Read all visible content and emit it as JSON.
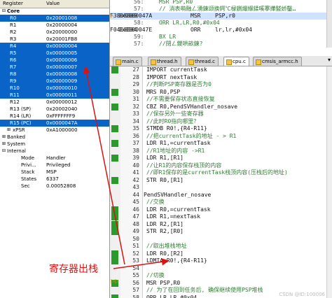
{
  "registers": {
    "header_name": "Register",
    "header_value": "Value",
    "rows": [
      {
        "tag": "⊟",
        "name": "Core",
        "value": "",
        "kind": "grp",
        "sel": false
      },
      {
        "tag": "",
        "name": "R0",
        "value": "0x20001008",
        "kind": "reg",
        "sel": true
      },
      {
        "tag": "",
        "name": "R1",
        "value": "0x20000004",
        "kind": "reg",
        "sel": false
      },
      {
        "tag": "",
        "name": "R2",
        "value": "0x20000000",
        "kind": "reg",
        "sel": false
      },
      {
        "tag": "",
        "name": "R3",
        "value": "0x20001FB8",
        "kind": "reg",
        "sel": false
      },
      {
        "tag": "",
        "name": "R4",
        "value": "0x00000004",
        "kind": "reg",
        "sel": true
      },
      {
        "tag": "",
        "name": "R5",
        "value": "0x00000005",
        "kind": "reg",
        "sel": true
      },
      {
        "tag": "",
        "name": "R6",
        "value": "0x00000006",
        "kind": "reg",
        "sel": true
      },
      {
        "tag": "",
        "name": "R7",
        "value": "0x00000007",
        "kind": "reg",
        "sel": true
      },
      {
        "tag": "",
        "name": "R8",
        "value": "0x00000008",
        "kind": "reg",
        "sel": true
      },
      {
        "tag": "",
        "name": "R9",
        "value": "0x00000009",
        "kind": "reg",
        "sel": true
      },
      {
        "tag": "",
        "name": "R10",
        "value": "0x00000010",
        "kind": "reg",
        "sel": true
      },
      {
        "tag": "",
        "name": "R11",
        "value": "0x00000011",
        "kind": "reg",
        "sel": true
      },
      {
        "tag": "",
        "name": "R12",
        "value": "0x00000012",
        "kind": "reg",
        "sel": false
      },
      {
        "tag": "",
        "name": "R13 (SP)",
        "value": "0x20002040",
        "kind": "reg",
        "sel": false
      },
      {
        "tag": "",
        "name": "R14 (LR)",
        "value": "0xFFFFFFF9",
        "kind": "reg",
        "sel": false
      },
      {
        "tag": "",
        "name": "R15 (PC)",
        "value": "0x0000047A",
        "kind": "reg",
        "sel": true
      },
      {
        "tag": "⊞",
        "name": "xPSR",
        "value": "0xA1000000",
        "kind": "grp2",
        "sel": false
      },
      {
        "tag": "⊞",
        "name": "Banked",
        "value": "",
        "kind": "grp",
        "sel": false
      },
      {
        "tag": "⊞",
        "name": "System",
        "value": "",
        "kind": "grp",
        "sel": false
      },
      {
        "tag": "⊟",
        "name": "Internal",
        "value": "",
        "kind": "grp",
        "sel": false
      },
      {
        "tag": "",
        "name": "Mode",
        "value": "Handler",
        "kind": "ind",
        "sel": false
      },
      {
        "tag": "",
        "name": "Privi...",
        "value": "Privileged",
        "kind": "ind",
        "sel": false
      },
      {
        "tag": "",
        "name": "Stack",
        "value": "MSP",
        "kind": "ind",
        "sel": false
      },
      {
        "tag": "",
        "name": "States",
        "value": "6337",
        "kind": "ind",
        "sel": false
      },
      {
        "tag": "",
        "name": "Sec",
        "value": "0.00052808",
        "kind": "ind",
        "sel": false
      }
    ]
  },
  "disasm": {
    "lines": [
      {
        "type": "src",
        "ln": "56:",
        "text": "MSR PSP,R0"
      },
      {
        "type": "src",
        "ln": "57:",
        "text": "// 消表萌融ㄥ湧鍊颂换鍔℃椂鍘熶緥鍒嗘搴撶盢娇鑿…"
      },
      {
        "type": "asm",
        "addr": "0x0000047A",
        "bytes": "F3808809",
        "mn": "MSR",
        "op": "PSP,r0",
        "cur": true
      },
      {
        "type": "src",
        "ln": "58:",
        "text": "ORR LR,LR,R0,#0x04"
      },
      {
        "type": "asm",
        "addr": "0x0000047E",
        "bytes": "F04E0E04",
        "mn": "ORR",
        "op": "lr,lr,#0x04",
        "cur": false
      },
      {
        "type": "src",
        "ln": "59:",
        "text": "BX LR"
      },
      {
        "type": "src",
        "ln": "57:",
        "text": "//閉ㄥ鍐哄畝鍊?"
      }
    ]
  },
  "tabs": [
    {
      "label": "main.c",
      "active": false
    },
    {
      "label": "thread.h",
      "active": false
    },
    {
      "label": "thread.c",
      "active": false
    },
    {
      "label": "cpu.c",
      "active": true
    },
    {
      "label": "cmsis_armcc.h",
      "active": false
    }
  ],
  "code": {
    "lines": [
      {
        "n": "27",
        "text": "IMPORT currentTask",
        "kind": "code",
        "mark": true
      },
      {
        "n": "28",
        "text": "IMPORT nextTask",
        "kind": "code",
        "mark": false
      },
      {
        "n": "29",
        "text": "//判断PSP寄存器是否为0",
        "kind": "cmt",
        "mark": false
      },
      {
        "n": "30",
        "text": "MRS R0,PSP",
        "kind": "code",
        "mark": true
      },
      {
        "n": "31",
        "text": "//不需要保存状态直接恢复",
        "kind": "cmt",
        "mark": false
      },
      {
        "n": "32",
        "text": "CBZ R0,PendSVHandler_nosave",
        "kind": "code",
        "mark": true
      },
      {
        "n": "33",
        "text": "//保存另外一些寄存器",
        "kind": "cmt",
        "mark": false
      },
      {
        "n": "34",
        "text": "//此时R0指向哪里？",
        "kind": "cmt",
        "mark": false
      },
      {
        "n": "35",
        "text": "STMDB R0!,{R4-R11}",
        "kind": "code",
        "mark": true
      },
      {
        "n": "36",
        "text": "//把currentTask的地址 - > R1",
        "kind": "cmt",
        "mark": false
      },
      {
        "n": "37",
        "text": "LDR R1,=currentTask",
        "kind": "code",
        "mark": true
      },
      {
        "n": "38",
        "text": "//R1地址的内容 ->R1",
        "kind": "cmt",
        "mark": false
      },
      {
        "n": "39",
        "text": "LDR R1,[R1]",
        "kind": "code",
        "mark": true
      },
      {
        "n": "40",
        "text": "//让R1的内容保存栈顶的内容",
        "kind": "cmt",
        "mark": false
      },
      {
        "n": "41",
        "text": "//即R1保存的是currentTask栈顶内容(压栈后的地址)",
        "kind": "cmt",
        "mark": false
      },
      {
        "n": "42",
        "text": "STR R0,[R1]",
        "kind": "code",
        "mark": true
      },
      {
        "n": "43",
        "text": "",
        "kind": "code",
        "mark": false
      },
      {
        "n": "44",
        "text": "PendSVHandler_nosave",
        "kind": "lbl",
        "mark": false
      },
      {
        "n": "45",
        "text": "//交换",
        "kind": "cmt",
        "mark": false
      },
      {
        "n": "46",
        "text": "LDR R0,=currentTask",
        "kind": "code",
        "mark": true
      },
      {
        "n": "47",
        "text": "LDR R1,=nextTask",
        "kind": "code",
        "mark": true
      },
      {
        "n": "48",
        "text": "LDR R2,[R1]",
        "kind": "code",
        "mark": true
      },
      {
        "n": "49",
        "text": "STR R2,[R0]",
        "kind": "code",
        "mark": true
      },
      {
        "n": "50",
        "text": "",
        "kind": "code",
        "mark": false
      },
      {
        "n": "51",
        "text": "//取出堆栈地址",
        "kind": "cmt",
        "mark": false
      },
      {
        "n": "52",
        "text": "LDR R0,[R2]",
        "kind": "code",
        "mark": true
      },
      {
        "n": "53",
        "text": "LDMIA R0!,{R4-R11}",
        "kind": "code",
        "mark": true
      },
      {
        "n": "54",
        "text": "",
        "kind": "code",
        "mark": false
      },
      {
        "n": "55",
        "text": "//切换",
        "kind": "cmt",
        "mark": false
      },
      {
        "n": "56",
        "text": "MSR PSP,R0",
        "kind": "code",
        "mark": true
      },
      {
        "n": "57",
        "text": "// 为了在回到任务后, 确保继续使用PSP堆栈",
        "kind": "cmt",
        "mark": false
      },
      {
        "n": "58",
        "text": "ORR LR,LR,#0x04",
        "kind": "code",
        "mark": true
      }
    ]
  },
  "annotation": {
    "label": "寄存器出栈",
    "color": "#e01010"
  },
  "watermark": "CSDN @ID:100006"
}
